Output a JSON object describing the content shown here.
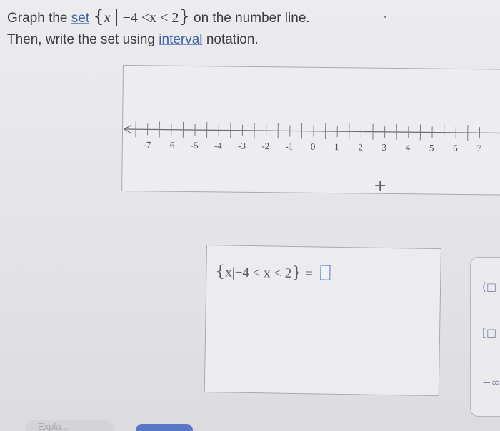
{
  "question": {
    "prefix": "Graph the",
    "set_link": "set",
    "brace_open": "{",
    "variable": "x",
    "condition": "−4 <x < 2",
    "brace_close": "}",
    "suffix": "on the number line.",
    "line2_prefix": "Then, write the set using",
    "interval_link": "interval",
    "line2_suffix": "notation."
  },
  "number_line": {
    "min": -7,
    "max": 7,
    "labels": [
      "-7",
      "-6",
      "-5",
      "-4",
      "-3",
      "-2",
      "-1",
      "0",
      "1",
      "2",
      "3",
      "4",
      "5",
      "6",
      "7"
    ],
    "cursor_symbol": "+"
  },
  "answer": {
    "brace_open": "{",
    "expression": "x|−4 < x < 2",
    "brace_close": "}",
    "equals": "="
  },
  "side_panel": {
    "buttons": [
      "(□",
      "[□",
      "−∞"
    ]
  },
  "footer": {
    "explain_label": "Expla..."
  },
  "colors": {
    "link": "#3b63a6",
    "input_border": "#4f7bd8",
    "button_primary": "#5a78c8"
  }
}
